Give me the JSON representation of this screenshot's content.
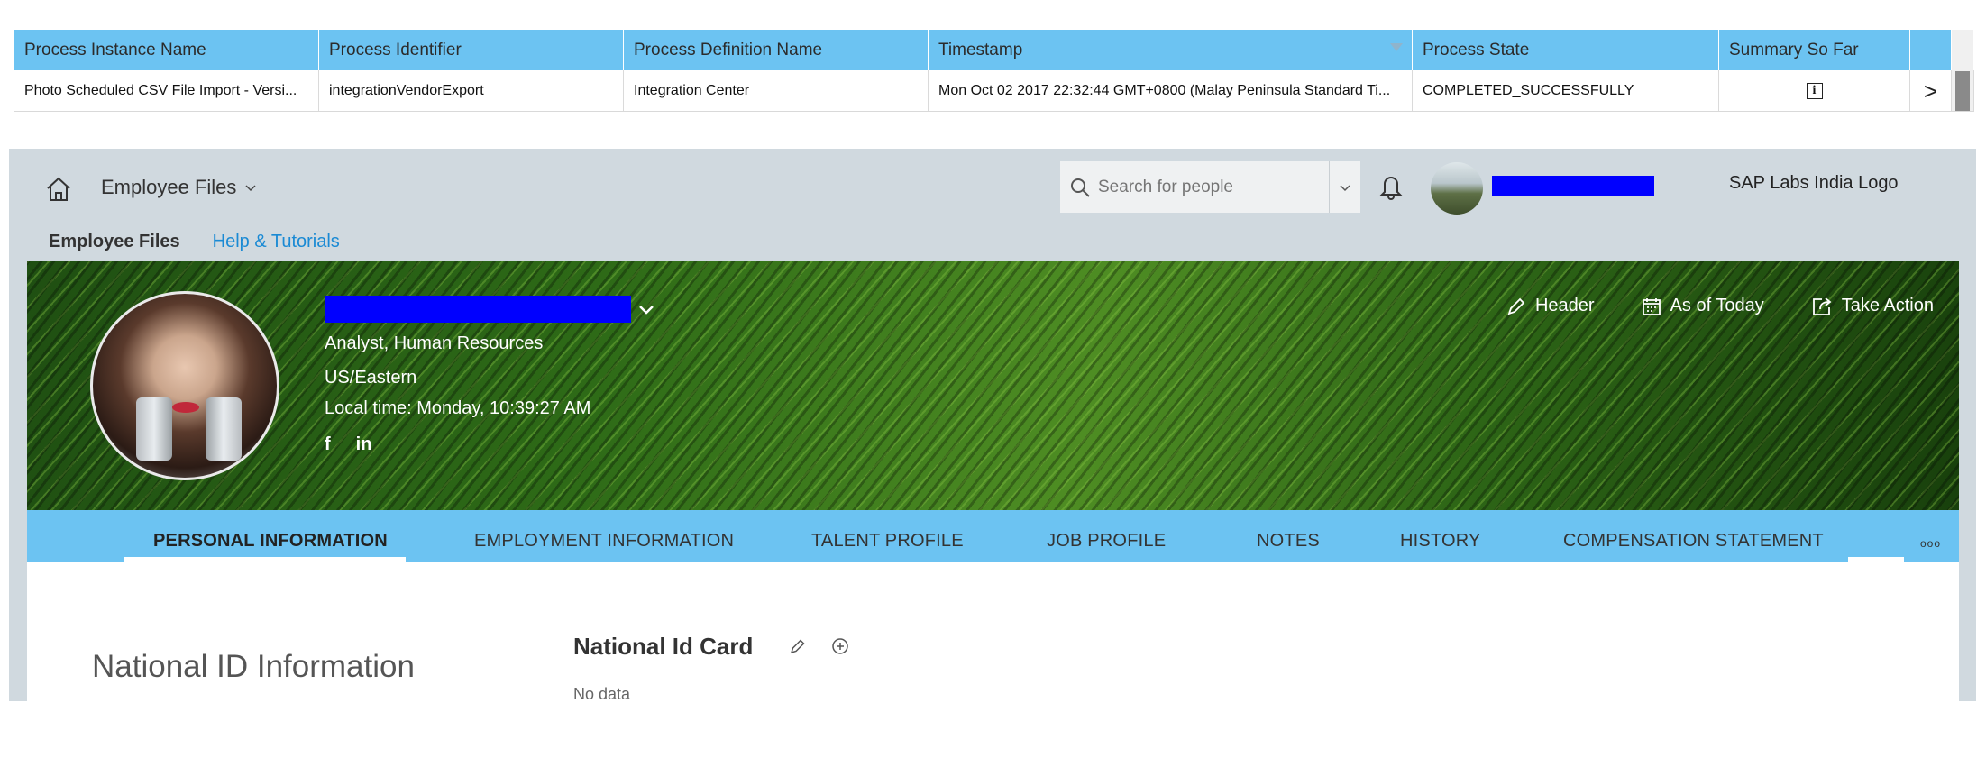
{
  "process_table": {
    "columns": [
      "Process Instance Name",
      "Process Identifier",
      "Process Definition Name",
      "Timestamp",
      "Process State",
      "Summary So Far",
      ""
    ],
    "row": {
      "instance_name": "Photo Scheduled CSV File Import - Versi...",
      "identifier": "integrationVendorExport",
      "definition_name": "Integration Center",
      "timestamp": "Mon Oct 02 2017 22:32:44 GMT+0800 (Malay Peninsula Standard Ti...",
      "state": "COMPLETED_SUCCESSFULLY",
      "summary_icon": "info-icon",
      "row_action": ">"
    }
  },
  "shell": {
    "product": "Employee Files",
    "search_placeholder": "Search for people",
    "user_name": "",
    "company_logo_alt": "SAP Labs India Logo"
  },
  "subnav": {
    "active": "Employee Files",
    "link": "Help & Tutorials"
  },
  "employee": {
    "name": "",
    "title": "Analyst, Human Resources",
    "timezone": "US/Eastern",
    "local_time": "Local time: Monday, 10:39:27 AM",
    "social": [
      "f",
      "in"
    ]
  },
  "banner_actions": {
    "header": "Header",
    "as_of": "As of Today",
    "take_action": "Take Action"
  },
  "tabs": [
    "PERSONAL INFORMATION",
    "EMPLOYMENT INFORMATION",
    "TALENT PROFILE",
    "JOB PROFILE",
    "NOTES",
    "HISTORY",
    "COMPENSATION STATEMENT"
  ],
  "more_label": "ooo",
  "content": {
    "section_title": "National ID Information",
    "card_title": "National Id Card",
    "no_data": "No data"
  },
  "colors": {
    "table_header": "#6cc3f2",
    "tab_bar": "#6cc3f2",
    "shell_bg": "#d0d9df",
    "link": "#1a8ad4",
    "redaction": "#0000ff"
  }
}
